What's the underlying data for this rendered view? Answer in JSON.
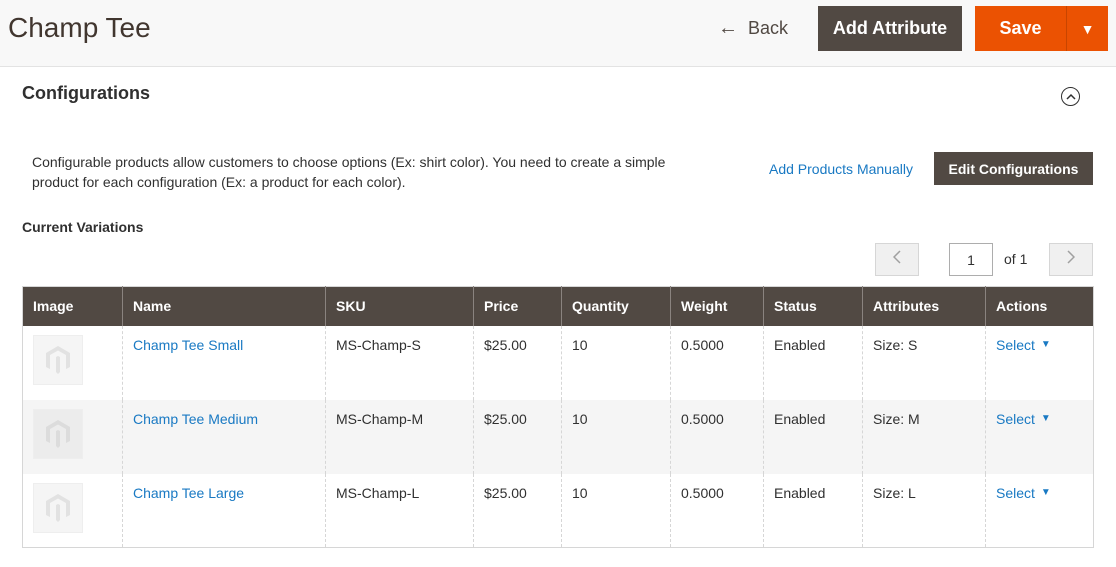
{
  "header": {
    "title": "Champ Tee",
    "back_label": "Back",
    "add_attribute_label": "Add Attribute",
    "save_label": "Save"
  },
  "section": {
    "title": "Configurations",
    "intro": "Configurable products allow customers to choose options (Ex: shirt color). You need to create a simple product for each configuration (Ex: a product for each color).",
    "add_manually_label": "Add Products Manually",
    "edit_config_label": "Edit Configurations",
    "variations_title": "Current Variations"
  },
  "pager": {
    "current": "1",
    "total_label": "of 1"
  },
  "table": {
    "columns": [
      "Image",
      "Name",
      "SKU",
      "Price",
      "Quantity",
      "Weight",
      "Status",
      "Attributes",
      "Actions"
    ],
    "rows": [
      {
        "name": "Champ Tee Small",
        "sku": "MS-Champ-S",
        "price": "$25.00",
        "qty": "10",
        "weight": "0.5000",
        "status": "Enabled",
        "attributes": "Size: S",
        "action": "Select"
      },
      {
        "name": "Champ Tee Medium",
        "sku": "MS-Champ-M",
        "price": "$25.00",
        "qty": "10",
        "weight": "0.5000",
        "status": "Enabled",
        "attributes": "Size: M",
        "action": "Select"
      },
      {
        "name": "Champ Tee Large",
        "sku": "MS-Champ-L",
        "price": "$25.00",
        "qty": "10",
        "weight": "0.5000",
        "status": "Enabled",
        "attributes": "Size: L",
        "action": "Select"
      }
    ]
  },
  "icons": {
    "back": "arrow-left-icon",
    "save_dropdown": "caret-down-icon",
    "collapse": "chevron-up-circle-icon",
    "pager_prev": "chevron-left-icon",
    "pager_next": "chevron-right-icon",
    "thumbnail": "magento-logo-placeholder-icon"
  },
  "colors": {
    "primary_dark": "#514943",
    "save_orange": "#eb5202",
    "link_blue": "#1979c3"
  }
}
